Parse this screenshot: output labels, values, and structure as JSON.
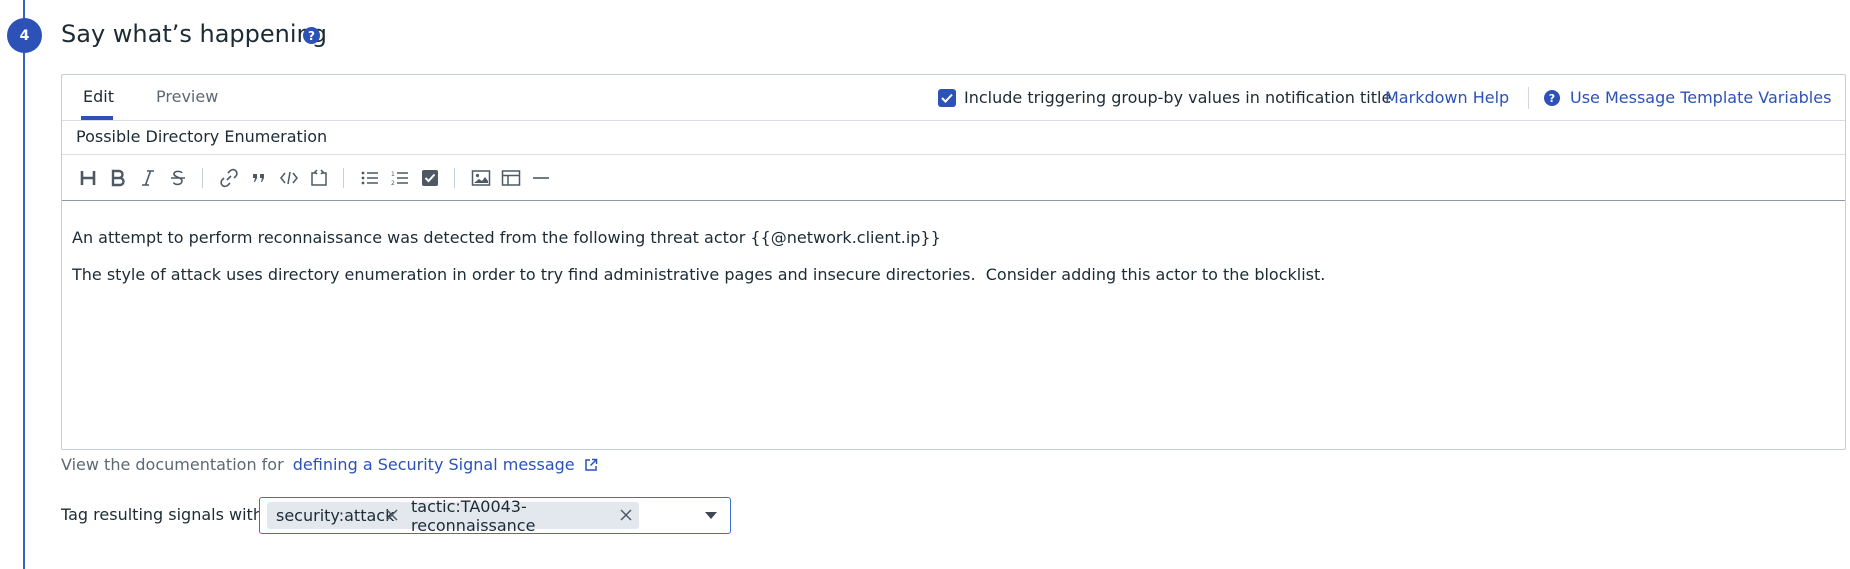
{
  "step": {
    "number": "4",
    "title": "Say what’s happening"
  },
  "tabs": [
    {
      "label": "Edit",
      "active": true
    },
    {
      "label": "Preview",
      "active": false
    }
  ],
  "options": {
    "include_groupby_label": "Include triggering group-by values in notification title",
    "include_groupby_checked": true,
    "markdown_help": "Markdown Help",
    "template_vars": "Use Message Template Variables"
  },
  "message": {
    "title": "Possible Directory Enumeration",
    "body_lines": [
      "An attempt to perform reconnaissance was detected from the following threat actor {{@network.client.ip}}",
      "The style of attack uses directory enumeration in order to try find administrative pages and insecure directories.  Consider adding this actor to the blocklist."
    ]
  },
  "toolbar_icons": [
    "heading-icon",
    "bold-icon",
    "italic-icon",
    "strikethrough-icon",
    "link-icon",
    "quote-icon",
    "code-icon",
    "code-block-icon",
    "bulleted-list-icon",
    "numbered-list-icon",
    "checklist-icon",
    "image-icon",
    "table-icon",
    "horizontal-rule-icon"
  ],
  "documentation": {
    "prefix": "View the documentation for",
    "link": "defining a Security Signal message"
  },
  "tags": {
    "label": "Tag resulting signals with",
    "items": [
      "security:attack",
      "tactic:TA0043-reconnaissance"
    ]
  },
  "colors": {
    "accent": "#2c52b8",
    "chip_bg": "#e3e8ef",
    "text": "#1c2b34"
  }
}
